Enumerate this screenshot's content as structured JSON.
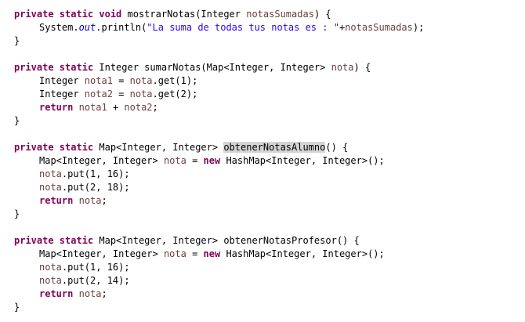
{
  "editor": {
    "lines": [
      {
        "tokens": [
          {
            "t": "private static void",
            "c": "kw"
          },
          {
            "t": " mostrarNotas(Integer ",
            "c": ""
          },
          {
            "t": "notasSumadas",
            "c": "var"
          },
          {
            "t": ") {",
            "c": ""
          }
        ]
      },
      {
        "indent": 1,
        "tokens": [
          {
            "t": "System.",
            "c": ""
          },
          {
            "t": "out",
            "c": "field"
          },
          {
            "t": ".println(",
            "c": ""
          },
          {
            "t": "\"La suma de todas tus notas es : \"",
            "c": "str"
          },
          {
            "t": "+",
            "c": ""
          },
          {
            "t": "notasSumadas",
            "c": "var"
          },
          {
            "t": ");",
            "c": ""
          }
        ]
      },
      {
        "tokens": [
          {
            "t": "}",
            "c": ""
          }
        ]
      },
      {
        "tokens": []
      },
      {
        "tokens": [
          {
            "t": "private static",
            "c": "kw"
          },
          {
            "t": " Integer sumarNotas(Map<Integer, Integer> ",
            "c": ""
          },
          {
            "t": "nota",
            "c": "var"
          },
          {
            "t": ") {",
            "c": ""
          }
        ]
      },
      {
        "indent": 1,
        "tokens": [
          {
            "t": "Integer ",
            "c": ""
          },
          {
            "t": "nota1",
            "c": "var"
          },
          {
            "t": " = ",
            "c": ""
          },
          {
            "t": "nota",
            "c": "var"
          },
          {
            "t": ".get(1);",
            "c": ""
          }
        ]
      },
      {
        "indent": 1,
        "tokens": [
          {
            "t": "Integer ",
            "c": ""
          },
          {
            "t": "nota2",
            "c": "var"
          },
          {
            "t": " = ",
            "c": ""
          },
          {
            "t": "nota",
            "c": "var"
          },
          {
            "t": ".get(2);",
            "c": ""
          }
        ]
      },
      {
        "indent": 1,
        "tokens": [
          {
            "t": "return",
            "c": "kw"
          },
          {
            "t": " ",
            "c": ""
          },
          {
            "t": "nota1",
            "c": "var"
          },
          {
            "t": " + ",
            "c": ""
          },
          {
            "t": "nota2",
            "c": "var"
          },
          {
            "t": ";",
            "c": ""
          }
        ]
      },
      {
        "tokens": [
          {
            "t": "}",
            "c": ""
          }
        ]
      },
      {
        "tokens": []
      },
      {
        "tokens": [
          {
            "t": "private static",
            "c": "kw"
          },
          {
            "t": " Map<Integer, Integer> ",
            "c": ""
          },
          {
            "t": "obtenerNotasAlumno",
            "c": "hl"
          },
          {
            "t": "() {",
            "c": ""
          }
        ]
      },
      {
        "indent": 1,
        "tokens": [
          {
            "t": "Map<Integer, Integer> ",
            "c": ""
          },
          {
            "t": "nota",
            "c": "var"
          },
          {
            "t": " = ",
            "c": ""
          },
          {
            "t": "new",
            "c": "kw"
          },
          {
            "t": " HashMap<Integer, Integer>();",
            "c": ""
          }
        ]
      },
      {
        "indent": 1,
        "tokens": [
          {
            "t": "nota",
            "c": "var"
          },
          {
            "t": ".put(1, 16);",
            "c": ""
          }
        ]
      },
      {
        "indent": 1,
        "tokens": [
          {
            "t": "nota",
            "c": "var"
          },
          {
            "t": ".put(2, 18);",
            "c": ""
          }
        ]
      },
      {
        "indent": 1,
        "tokens": [
          {
            "t": "return",
            "c": "kw"
          },
          {
            "t": " ",
            "c": ""
          },
          {
            "t": "nota",
            "c": "var"
          },
          {
            "t": ";",
            "c": ""
          }
        ]
      },
      {
        "tokens": [
          {
            "t": "}",
            "c": ""
          }
        ]
      },
      {
        "tokens": []
      },
      {
        "tokens": [
          {
            "t": "private static",
            "c": "kw"
          },
          {
            "t": " Map<Integer, Integer> obtenerNotasProfesor() {",
            "c": ""
          }
        ]
      },
      {
        "indent": 1,
        "tokens": [
          {
            "t": "Map<Integer, Integer> ",
            "c": ""
          },
          {
            "t": "nota",
            "c": "var"
          },
          {
            "t": " = ",
            "c": ""
          },
          {
            "t": "new",
            "c": "kw"
          },
          {
            "t": " HashMap<Integer, Integer>();",
            "c": ""
          }
        ]
      },
      {
        "indent": 1,
        "tokens": [
          {
            "t": "nota",
            "c": "var"
          },
          {
            "t": ".put(1, 16);",
            "c": ""
          }
        ]
      },
      {
        "indent": 1,
        "tokens": [
          {
            "t": "nota",
            "c": "var"
          },
          {
            "t": ".put(2, 14);",
            "c": ""
          }
        ]
      },
      {
        "indent": 1,
        "tokens": [
          {
            "t": "return",
            "c": "kw"
          },
          {
            "t": " ",
            "c": ""
          },
          {
            "t": "nota",
            "c": "var"
          },
          {
            "t": ";",
            "c": ""
          }
        ]
      },
      {
        "tokens": [
          {
            "t": "}",
            "c": ""
          }
        ]
      }
    ]
  },
  "colors": {
    "keyword": "#7f0055",
    "local_variable": "#6a3e3e",
    "static_field": "#0000c0",
    "string": "#2a00ff",
    "selection_highlight": "#d4d4d4"
  }
}
